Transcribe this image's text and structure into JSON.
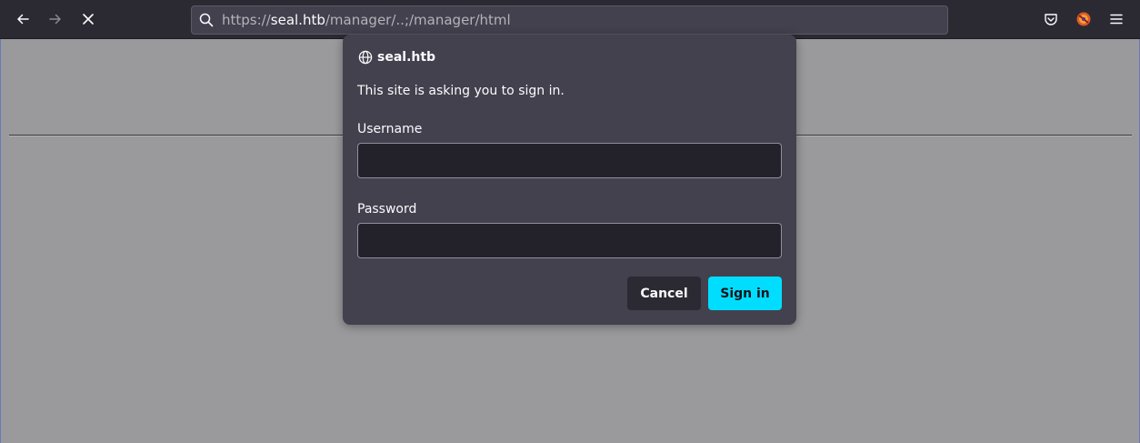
{
  "browser": {
    "url": {
      "scheme": "https://",
      "host": "seal.htb",
      "path": "/manager/..;/manager/html"
    },
    "icons": {
      "back": "arrow-left-icon",
      "forward": "arrow-right-icon",
      "stop": "close-icon",
      "search": "search-icon",
      "pocket": "pocket-icon",
      "extension": "extension-icon",
      "menu": "hamburger-menu-icon"
    }
  },
  "dialog": {
    "host": "seal.htb",
    "message": "This site is asking you to sign in.",
    "username_label": "Username",
    "username_value": "",
    "password_label": "Password",
    "password_value": "",
    "cancel_label": "Cancel",
    "signin_label": "Sign in"
  },
  "colors": {
    "toolbar": "#2b2a33",
    "dialog_bg": "#42414d",
    "primary_button": "#00ddff",
    "page_bg": "#9a9a9c"
  }
}
